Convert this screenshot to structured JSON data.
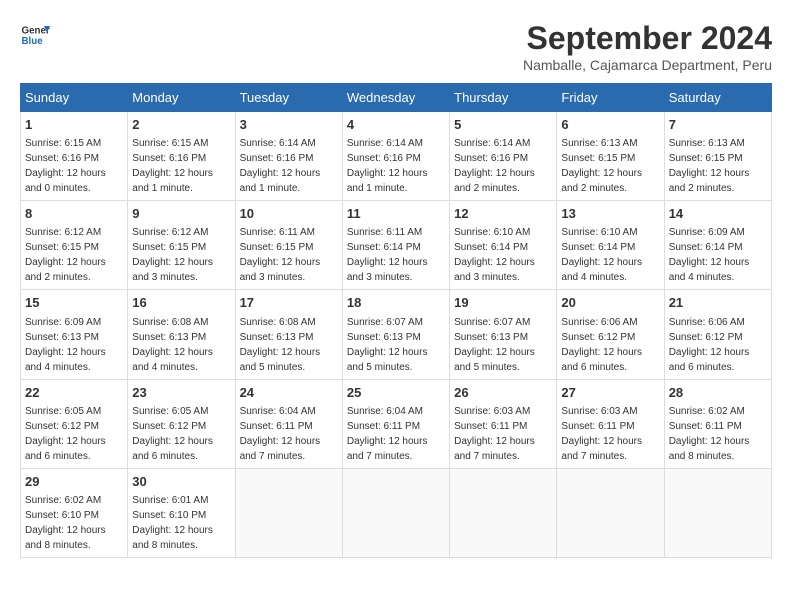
{
  "logo": {
    "line1": "General",
    "line2": "Blue"
  },
  "title": {
    "month_year": "September 2024",
    "location": "Namballe, Cajamarca Department, Peru"
  },
  "weekdays": [
    "Sunday",
    "Monday",
    "Tuesday",
    "Wednesday",
    "Thursday",
    "Friday",
    "Saturday"
  ],
  "weeks": [
    [
      {
        "day": "1",
        "sunrise": "6:15 AM",
        "sunset": "6:16 PM",
        "daylight": "12 hours and 0 minutes."
      },
      {
        "day": "2",
        "sunrise": "6:15 AM",
        "sunset": "6:16 PM",
        "daylight": "12 hours and 1 minute."
      },
      {
        "day": "3",
        "sunrise": "6:14 AM",
        "sunset": "6:16 PM",
        "daylight": "12 hours and 1 minute."
      },
      {
        "day": "4",
        "sunrise": "6:14 AM",
        "sunset": "6:16 PM",
        "daylight": "12 hours and 1 minute."
      },
      {
        "day": "5",
        "sunrise": "6:14 AM",
        "sunset": "6:16 PM",
        "daylight": "12 hours and 2 minutes."
      },
      {
        "day": "6",
        "sunrise": "6:13 AM",
        "sunset": "6:15 PM",
        "daylight": "12 hours and 2 minutes."
      },
      {
        "day": "7",
        "sunrise": "6:13 AM",
        "sunset": "6:15 PM",
        "daylight": "12 hours and 2 minutes."
      }
    ],
    [
      {
        "day": "8",
        "sunrise": "6:12 AM",
        "sunset": "6:15 PM",
        "daylight": "12 hours and 2 minutes."
      },
      {
        "day": "9",
        "sunrise": "6:12 AM",
        "sunset": "6:15 PM",
        "daylight": "12 hours and 3 minutes."
      },
      {
        "day": "10",
        "sunrise": "6:11 AM",
        "sunset": "6:15 PM",
        "daylight": "12 hours and 3 minutes."
      },
      {
        "day": "11",
        "sunrise": "6:11 AM",
        "sunset": "6:14 PM",
        "daylight": "12 hours and 3 minutes."
      },
      {
        "day": "12",
        "sunrise": "6:10 AM",
        "sunset": "6:14 PM",
        "daylight": "12 hours and 3 minutes."
      },
      {
        "day": "13",
        "sunrise": "6:10 AM",
        "sunset": "6:14 PM",
        "daylight": "12 hours and 4 minutes."
      },
      {
        "day": "14",
        "sunrise": "6:09 AM",
        "sunset": "6:14 PM",
        "daylight": "12 hours and 4 minutes."
      }
    ],
    [
      {
        "day": "15",
        "sunrise": "6:09 AM",
        "sunset": "6:13 PM",
        "daylight": "12 hours and 4 minutes."
      },
      {
        "day": "16",
        "sunrise": "6:08 AM",
        "sunset": "6:13 PM",
        "daylight": "12 hours and 4 minutes."
      },
      {
        "day": "17",
        "sunrise": "6:08 AM",
        "sunset": "6:13 PM",
        "daylight": "12 hours and 5 minutes."
      },
      {
        "day": "18",
        "sunrise": "6:07 AM",
        "sunset": "6:13 PM",
        "daylight": "12 hours and 5 minutes."
      },
      {
        "day": "19",
        "sunrise": "6:07 AM",
        "sunset": "6:13 PM",
        "daylight": "12 hours and 5 minutes."
      },
      {
        "day": "20",
        "sunrise": "6:06 AM",
        "sunset": "6:12 PM",
        "daylight": "12 hours and 6 minutes."
      },
      {
        "day": "21",
        "sunrise": "6:06 AM",
        "sunset": "6:12 PM",
        "daylight": "12 hours and 6 minutes."
      }
    ],
    [
      {
        "day": "22",
        "sunrise": "6:05 AM",
        "sunset": "6:12 PM",
        "daylight": "12 hours and 6 minutes."
      },
      {
        "day": "23",
        "sunrise": "6:05 AM",
        "sunset": "6:12 PM",
        "daylight": "12 hours and 6 minutes."
      },
      {
        "day": "24",
        "sunrise": "6:04 AM",
        "sunset": "6:11 PM",
        "daylight": "12 hours and 7 minutes."
      },
      {
        "day": "25",
        "sunrise": "6:04 AM",
        "sunset": "6:11 PM",
        "daylight": "12 hours and 7 minutes."
      },
      {
        "day": "26",
        "sunrise": "6:03 AM",
        "sunset": "6:11 PM",
        "daylight": "12 hours and 7 minutes."
      },
      {
        "day": "27",
        "sunrise": "6:03 AM",
        "sunset": "6:11 PM",
        "daylight": "12 hours and 7 minutes."
      },
      {
        "day": "28",
        "sunrise": "6:02 AM",
        "sunset": "6:11 PM",
        "daylight": "12 hours and 8 minutes."
      }
    ],
    [
      {
        "day": "29",
        "sunrise": "6:02 AM",
        "sunset": "6:10 PM",
        "daylight": "12 hours and 8 minutes."
      },
      {
        "day": "30",
        "sunrise": "6:01 AM",
        "sunset": "6:10 PM",
        "daylight": "12 hours and 8 minutes."
      },
      null,
      null,
      null,
      null,
      null
    ]
  ],
  "labels": {
    "sunrise_prefix": "Sunrise: ",
    "sunset_prefix": "Sunset: ",
    "daylight_prefix": "Daylight: "
  }
}
